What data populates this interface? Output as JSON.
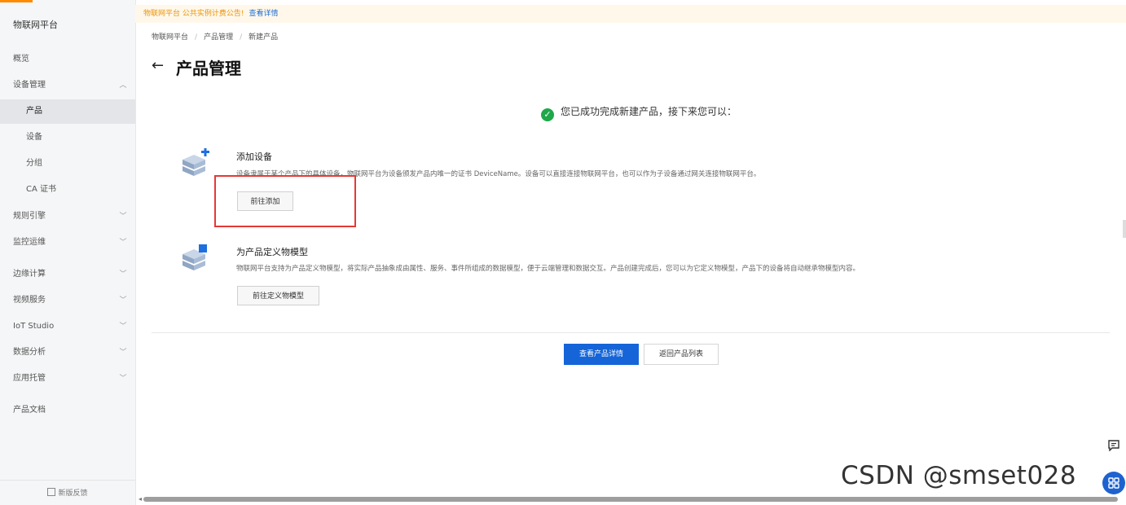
{
  "sidebar": {
    "title": "物联网平台",
    "items": [
      {
        "label": "概览",
        "sub": false,
        "chevron": ""
      },
      {
        "label": "设备管理",
        "sub": false,
        "chevron": "︿"
      },
      {
        "label": "产品",
        "sub": true,
        "chevron": "",
        "active": true
      },
      {
        "label": "设备",
        "sub": true,
        "chevron": ""
      },
      {
        "label": "分组",
        "sub": true,
        "chevron": ""
      },
      {
        "label": "CA 证书",
        "sub": true,
        "chevron": ""
      },
      {
        "label": "规则引擎",
        "sub": false,
        "chevron": "﹀"
      },
      {
        "label": "监控运维",
        "sub": false,
        "chevron": "﹀"
      },
      {
        "label": "边缘计算",
        "sub": false,
        "chevron": "﹀"
      },
      {
        "label": "视频服务",
        "sub": false,
        "chevron": "﹀"
      },
      {
        "label": "IoT Studio",
        "sub": false,
        "chevron": "﹀"
      },
      {
        "label": "数据分析",
        "sub": false,
        "chevron": "﹀"
      },
      {
        "label": "应用托管",
        "sub": false,
        "chevron": "﹀"
      },
      {
        "label": "产品文档",
        "sub": false,
        "chevron": ""
      }
    ],
    "feedback": "新版反馈"
  },
  "notice": {
    "text": "物联网平台 公共实例计费公告!",
    "link": "查看详情"
  },
  "breadcrumb": [
    "物联网平台",
    "产品管理",
    "新建产品"
  ],
  "page": {
    "back_icon": "←",
    "title": "产品管理"
  },
  "success": {
    "icon": "✓",
    "text": "您已成功完成新建产品，接下来您可以："
  },
  "steps": [
    {
      "title": "添加设备",
      "desc": "设备隶属于某个产品下的具体设备，物联网平台为设备颁发产品内唯一的证书 DeviceName。设备可以直接连接物联网平台，也可以作为子设备通过网关连接物联网平台。",
      "button": "前往添加"
    },
    {
      "title": "为产品定义物模型",
      "desc": "物联网平台支持为产品定义物模型，将实际产品抽象成由属性、服务、事件所组成的数据模型，便于云端管理和数据交互。产品创建完成后，您可以为它定义物模型，产品下的设备将自动继承物模型内容。",
      "button": "前往定义物模型"
    }
  ],
  "actions": {
    "primary": "查看产品详情",
    "secondary": "返回产品列表"
  },
  "watermark": "CSDN @smset028",
  "colors": {
    "primary": "#1565d8",
    "success": "#1fa84a",
    "highlight": "#e53935",
    "notice_text": "#e8930c"
  }
}
